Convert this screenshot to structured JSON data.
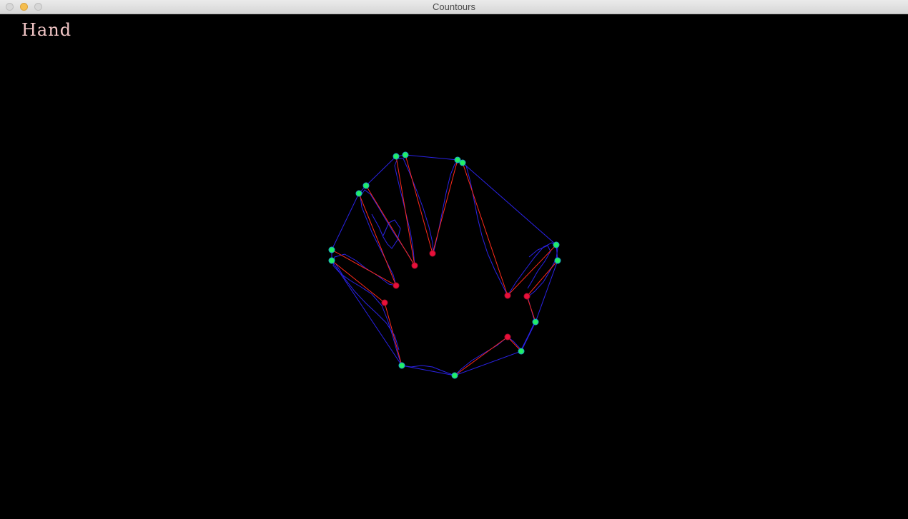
{
  "window": {
    "title": "Countours",
    "controls": [
      "close",
      "minimize",
      "zoom"
    ]
  },
  "overlay": {
    "label": "Hand",
    "label_color": "#f2c6c6"
  },
  "colors": {
    "contour": "#2a22e6",
    "hull": "#2a22e6",
    "defect_line": "#ff2a1a",
    "hull_point": "#22ee66",
    "defect_point": "#e8103a",
    "background": "#000000"
  },
  "icons": {
    "close": "close-circle-icon",
    "minimize": "minimize-circle-icon",
    "zoom": "zoom-circle-icon"
  }
}
